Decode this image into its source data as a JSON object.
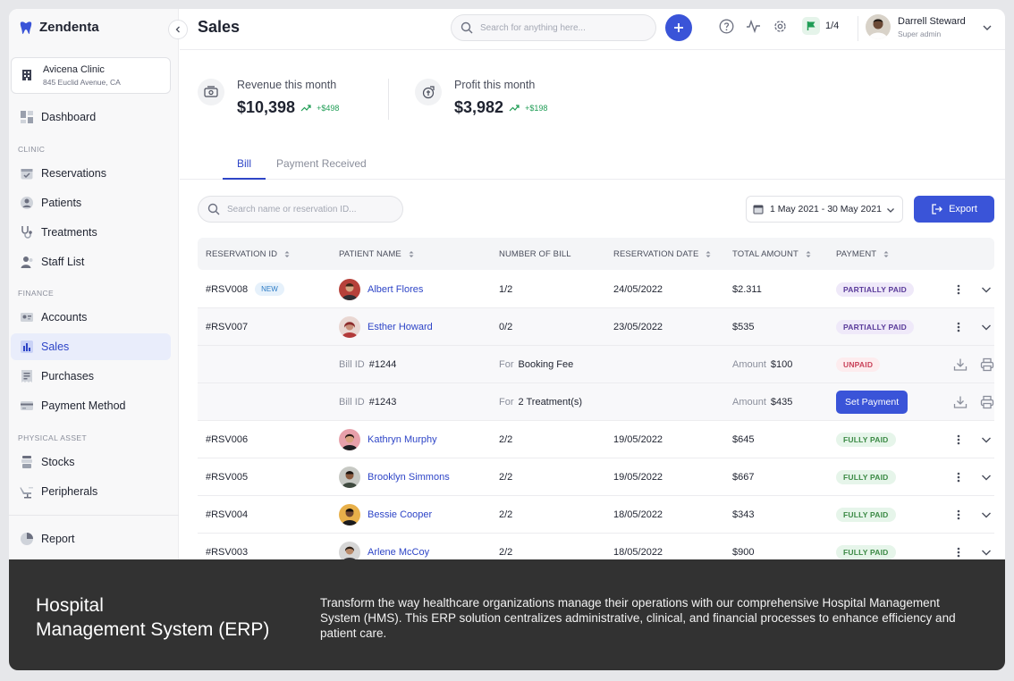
{
  "app": {
    "name": "Zendenta"
  },
  "clinic": {
    "name": "Avicena Clinic",
    "address": "845 Euclid Avenue, CA"
  },
  "sidebar": {
    "dashboard": "Dashboard",
    "clinic_section": "CLINIC",
    "reservations": "Reservations",
    "patients": "Patients",
    "treatments": "Treatments",
    "staff_list": "Staff List",
    "finance_section": "FINANCE",
    "accounts": "Accounts",
    "sales": "Sales",
    "purchases": "Purchases",
    "payment_method": "Payment Method",
    "asset_section": "PHYSICAL ASSET",
    "stocks": "Stocks",
    "peripherals": "Peripherals",
    "report": "Report"
  },
  "header": {
    "title": "Sales",
    "search_placeholder": "Search for anything here...",
    "flag_count": "1/4",
    "user_name": "Darrell Steward",
    "user_role": "Super admin"
  },
  "stats": {
    "revenue_label": "Revenue this month",
    "revenue_value": "$10,398",
    "revenue_change": "+$498",
    "profit_label": "Profit this month",
    "profit_value": "$3,982",
    "profit_change": "+$198"
  },
  "tabs": {
    "bill": "Bill",
    "payment_received": "Payment Received"
  },
  "toolbar": {
    "search_placeholder": "Search name or reservation ID...",
    "date_range": "1 May 2021 - 30 May 2021",
    "export_label": "Export"
  },
  "table": {
    "headers": [
      "RESERVATION ID",
      "PATIENT NAME",
      "NUMBER OF BILL",
      "RESERVATION DATE",
      "TOTAL AMOUNT",
      "PAYMENT"
    ],
    "rows": [
      {
        "id": "#RSV008",
        "badge": "NEW",
        "patient": "Albert Flores",
        "bills": "1/2",
        "date": "24/05/2022",
        "amount": "$2.311",
        "payment": "PARTIALLY PAID"
      },
      {
        "id": "#RSV007",
        "badge": "",
        "patient": "Esther Howard",
        "bills": "0/2",
        "date": "23/05/2022",
        "amount": "$535",
        "payment": "PARTIALLY PAID"
      },
      {
        "id": "#RSV006",
        "badge": "",
        "patient": "Kathryn Murphy",
        "bills": "2/2",
        "date": "19/05/2022",
        "amount": "$645",
        "payment": "FULLY PAID"
      },
      {
        "id": "#RSV005",
        "badge": "",
        "patient": "Brooklyn Simmons",
        "bills": "2/2",
        "date": "19/05/2022",
        "amount": "$667",
        "payment": "FULLY PAID"
      },
      {
        "id": "#RSV004",
        "badge": "",
        "patient": "Bessie Cooper",
        "bills": "2/2",
        "date": "18/05/2022",
        "amount": "$343",
        "payment": "FULLY PAID"
      },
      {
        "id": "#RSV003",
        "badge": "",
        "patient": "Arlene McCoy",
        "bills": "2/2",
        "date": "18/05/2022",
        "amount": "$900",
        "payment": "FULLY PAID"
      }
    ],
    "sub_rows": [
      {
        "bill_id_label": "Bill ID",
        "bill_id": "#1244",
        "for_label": "For",
        "for_value": "Booking Fee",
        "amount_label": "Amount",
        "amount": "$100",
        "status": "UNPAID"
      },
      {
        "bill_id_label": "Bill ID",
        "bill_id": "#1243",
        "for_label": "For",
        "for_value": "2 Treatment(s)",
        "amount_label": "Amount",
        "amount": "$435",
        "action": "Set Payment"
      }
    ]
  },
  "overlay": {
    "title_line1": "Hospital",
    "title_line2": "Management System (ERP)",
    "description": "Transform the way healthcare organizations manage their operations with our comprehensive Hospital Management System (HMS). This ERP solution centralizes administrative, clinical, and financial processes to enhance efficiency and patient care."
  },
  "colors": {
    "accent": "#3a54d8",
    "success": "#1f9d55",
    "overlay_bg": "#323232"
  }
}
